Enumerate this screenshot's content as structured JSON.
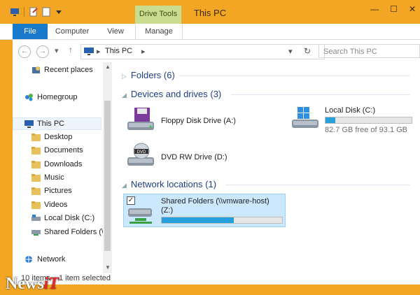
{
  "window": {
    "title": "This PC",
    "context_tab": "Drive Tools",
    "min": "—",
    "max": "☐",
    "close": "✕"
  },
  "ribbon": {
    "tabs": [
      "File",
      "Computer",
      "View",
      "Manage"
    ]
  },
  "address": {
    "crumb": "This PC",
    "search_placeholder": "Search This PC"
  },
  "nav": {
    "items": [
      {
        "label": "Recent places",
        "icon": "recent-places-icon"
      },
      {
        "label": "Homegroup",
        "icon": "homegroup-icon"
      },
      {
        "label": "This PC",
        "icon": "this-pc-icon"
      },
      {
        "label": "Desktop",
        "icon": "folder-icon"
      },
      {
        "label": "Documents",
        "icon": "folder-icon"
      },
      {
        "label": "Downloads",
        "icon": "folder-icon"
      },
      {
        "label": "Music",
        "icon": "folder-icon"
      },
      {
        "label": "Pictures",
        "icon": "folder-icon"
      },
      {
        "label": "Videos",
        "icon": "folder-icon"
      },
      {
        "label": "Local Disk (C:)",
        "icon": "drive-icon"
      },
      {
        "label": "Shared Folders (\\",
        "icon": "network-drive-icon"
      },
      {
        "label": "Network",
        "icon": "network-icon"
      }
    ]
  },
  "main": {
    "folders_header": "Folders (6)",
    "devices_header": "Devices and drives (3)",
    "network_header": "Network locations (1)",
    "floppy": "Floppy Disk Drive (A:)",
    "local_disk": {
      "name": "Local Disk (C:)",
      "free": "82.7 GB free of 93.1 GB",
      "used_fraction": 0.11
    },
    "dvd": "DVD RW Drive (D:)",
    "shared": {
      "name_line1": "Shared Folders (\\\\vmware-host)",
      "name_line2": "(Z:)",
      "used_fraction": 0.6
    }
  },
  "status": {
    "count": "10 items",
    "selected": "1 item selected"
  },
  "watermark": {
    "text": "News",
    "accent": "iT"
  },
  "colors": {
    "accent": "#f3a524",
    "file_tab": "#1979ca",
    "progress": "#26a0da",
    "group_text": "#1e3f87"
  }
}
